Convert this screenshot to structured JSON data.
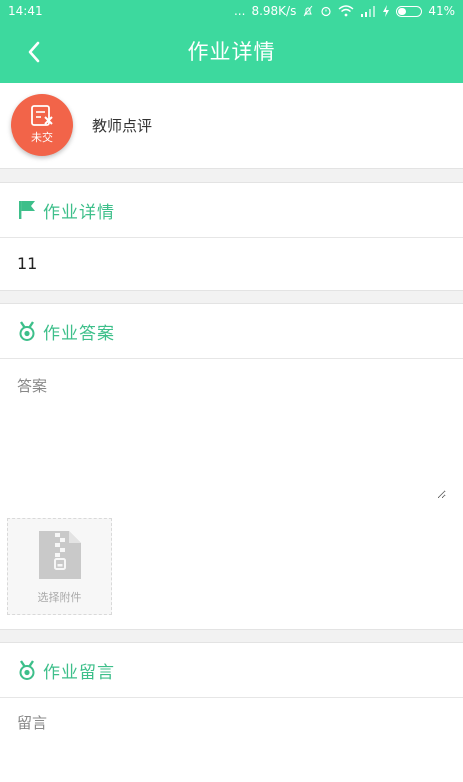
{
  "status_bar": {
    "time": "14:41",
    "dots": "...",
    "network_speed": "8.98K/s",
    "battery_percent": "41%",
    "battery_level": 0.41
  },
  "nav": {
    "title": "作业详情",
    "back_icon": "chevron-left-icon"
  },
  "teacher": {
    "status_label": "未交",
    "status_icon": "document-x-icon",
    "comment_label": "教师点评"
  },
  "detail": {
    "title": "作业详情",
    "icon": "flag-icon",
    "value": "11"
  },
  "answer": {
    "title": "作业答案",
    "icon": "medal-icon",
    "placeholder": "答案",
    "attach_label": "选择附件",
    "attach_icon": "zip-file-icon"
  },
  "message": {
    "title": "作业留言",
    "icon": "medal-icon",
    "placeholder": "留言"
  },
  "colors": {
    "primary": "#3dd99e",
    "accent_text": "#3dbf8a",
    "status_red": "#f26449"
  }
}
